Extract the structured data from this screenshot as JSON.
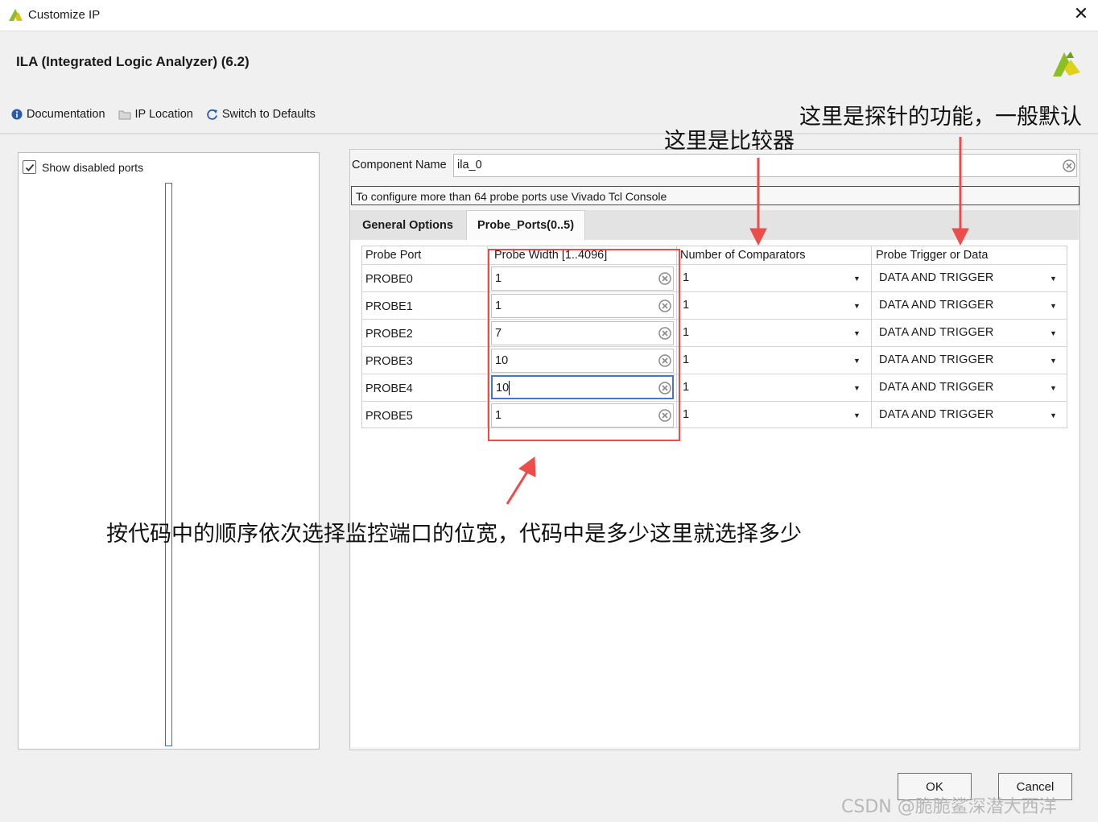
{
  "window": {
    "title": "Customize IP",
    "close_glyph": "✕"
  },
  "header": {
    "title": "ILA (Integrated Logic Analyzer) (6.2)"
  },
  "toolbar": {
    "documentation": "Documentation",
    "ip_location": "IP Location",
    "switch_defaults": "Switch to Defaults"
  },
  "left": {
    "show_disabled_label": "Show disabled ports",
    "show_disabled_checked": true
  },
  "component": {
    "label": "Component Name",
    "value": "ila_0"
  },
  "info": {
    "message": "To configure more than 64 probe ports use Vivado Tcl Console"
  },
  "tabs": [
    {
      "label": "General Options",
      "active": false
    },
    {
      "label": "Probe_Ports(0..5)",
      "active": true
    }
  ],
  "table": {
    "headers": [
      "Probe Port",
      "Probe Width [1..4096]",
      "Number of Comparators",
      "Probe Trigger or Data"
    ],
    "rows": [
      {
        "port": "PROBE0",
        "width": "1",
        "comparators": "1",
        "trigger": "DATA AND TRIGGER"
      },
      {
        "port": "PROBE1",
        "width": "1",
        "comparators": "1",
        "trigger": "DATA AND TRIGGER"
      },
      {
        "port": "PROBE2",
        "width": "7",
        "comparators": "1",
        "trigger": "DATA AND TRIGGER"
      },
      {
        "port": "PROBE3",
        "width": "10",
        "comparators": "1",
        "trigger": "DATA AND TRIGGER"
      },
      {
        "port": "PROBE4",
        "width": "10",
        "comparators": "1",
        "trigger": "DATA AND TRIGGER",
        "focused": true
      },
      {
        "port": "PROBE5",
        "width": "1",
        "comparators": "1",
        "trigger": "DATA AND TRIGGER"
      }
    ]
  },
  "annotations": {
    "probe_function": "这里是探针的功能，一般默认",
    "comparator": "这里是比较器",
    "width_note": "按代码中的顺序依次选择监控端口的位宽，代码中是多少这里就选择多少",
    "color": "#e94a4a"
  },
  "buttons": {
    "ok": "OK",
    "cancel": "Cancel"
  },
  "watermark": "CSDN @脆脆鲨深潜大西洋",
  "colors": {
    "accent_blue": "#4a74c9",
    "annotation_red": "#ee4b4b",
    "brand_green": "#7ab51d"
  }
}
